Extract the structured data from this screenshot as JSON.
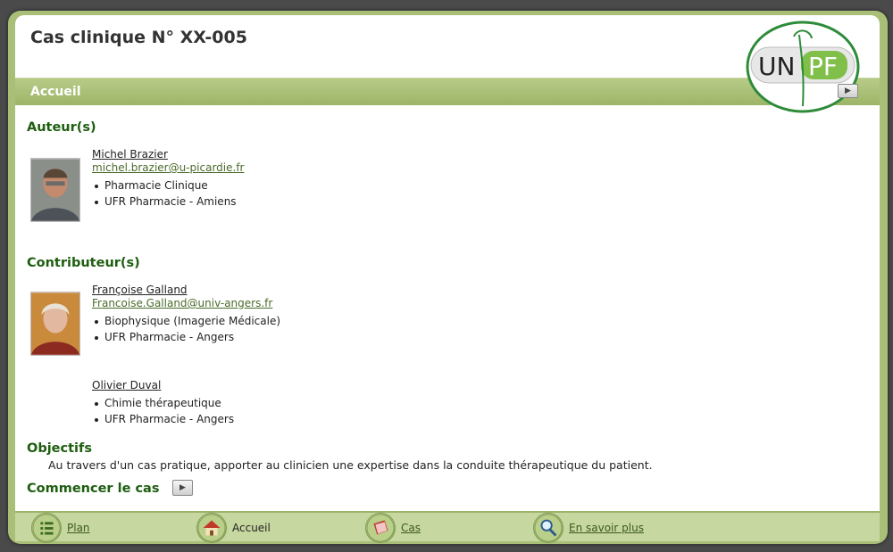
{
  "header": {
    "title": "Cas clinique N° XX-005"
  },
  "section": {
    "label": "Accueil"
  },
  "logo": {
    "text_un": "UN",
    "text_pf": "PF"
  },
  "authors": {
    "heading": "Auteur(s)",
    "people": [
      {
        "name": "Michel Brazier",
        "email": "michel.brazier@u-picardie.fr",
        "roles": [
          "Pharmacie Clinique",
          "UFR Pharmacie - Amiens"
        ]
      }
    ]
  },
  "contributors": {
    "heading": "Contributeur(s)",
    "people": [
      {
        "name": "Françoise Galland",
        "email": "Francoise.Galland@univ-angers.fr",
        "roles": [
          "Biophysique (Imagerie Médicale)",
          "UFR Pharmacie - Angers"
        ]
      },
      {
        "name": "Olivier Duval",
        "roles": [
          "Chimie thérapeutique",
          "UFR Pharmacie - Angers"
        ]
      }
    ]
  },
  "objectives": {
    "heading": "Objectifs",
    "text": "Au travers d'un cas pratique, apporter au clinicien une expertise dans la conduite thérapeutique du patient."
  },
  "start": {
    "label": "Commencer le cas",
    "button": "▶"
  },
  "footer": {
    "items": [
      {
        "label": "Plan",
        "icon": "list-icon"
      },
      {
        "label": "Accueil",
        "icon": "home-icon"
      },
      {
        "label": "Cas",
        "icon": "book-icon"
      },
      {
        "label": "En savoir plus",
        "icon": "magnifier-icon"
      }
    ]
  },
  "colors": {
    "accent_green": "#1e5e10",
    "bar_green": "#a9bf78",
    "frame": "#4a4a4a"
  }
}
